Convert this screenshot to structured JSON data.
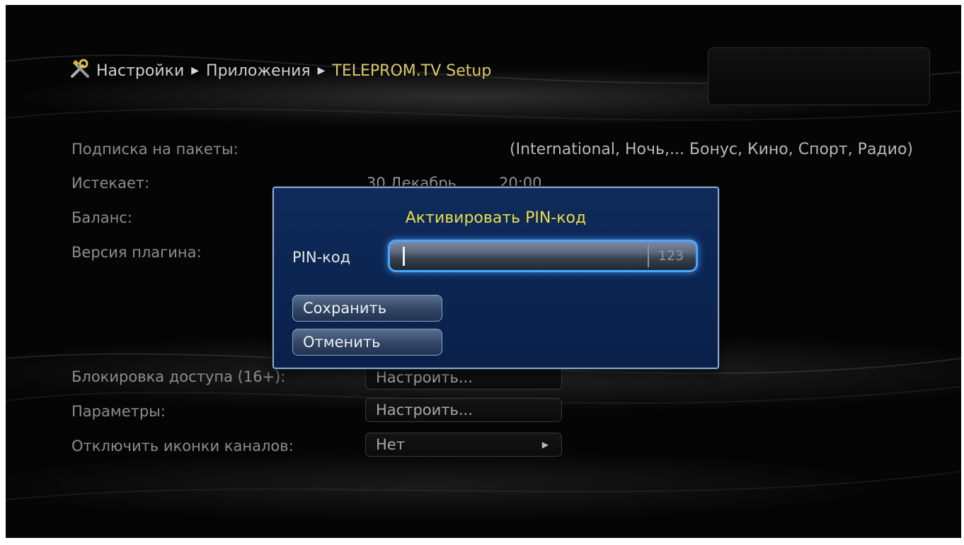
{
  "breadcrumb": {
    "icon": "tools-icon",
    "items": [
      "Настройки",
      "Приложения",
      "TELEPROM.TV Setup"
    ]
  },
  "info": {
    "subscription_label": "Подписка на пакеты:",
    "subscription_value": "(International, Ночь,... Бонус, Кино, Спорт, Радио)",
    "expires_label": "Истекает:",
    "expires_value": "30 Декабрь ....... 20:00",
    "balance_label": "Баланс:",
    "plugin_version_label": "Версия плагина:"
  },
  "settings": {
    "access_lock_label": "Блокировка доступа (16+):",
    "access_lock_button": "Настроить...",
    "parameters_label": "Параметры:",
    "parameters_button": "Настроить...",
    "disable_icons_label": "Отключить иконки каналов:",
    "disable_icons_value": "Нет"
  },
  "dialog": {
    "title": "Активировать PIN-код",
    "pin_label": "PIN-код",
    "pin_value": "",
    "input_mode": "123",
    "save_button": "Сохранить",
    "cancel_button": "Отменить"
  },
  "colors": {
    "accent_yellow": "#eadd49",
    "dialog_bg": "#0f2b5b",
    "focus_blue": "#49a8ff"
  }
}
